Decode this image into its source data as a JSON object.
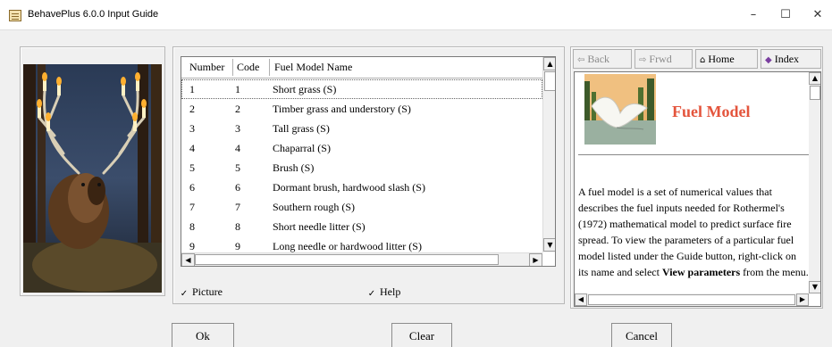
{
  "window": {
    "title": "BehavePlus 6.0.0 Input Guide",
    "controls": {
      "minimize": "–",
      "maximize": "☐",
      "close": "✕"
    }
  },
  "list": {
    "headers": [
      "Number",
      "Code",
      "Fuel Model Name"
    ],
    "rows": [
      {
        "number": "1",
        "code": "1",
        "name": "Short grass (S)"
      },
      {
        "number": "2",
        "code": "2",
        "name": "Timber grass and understory (S)"
      },
      {
        "number": "3",
        "code": "3",
        "name": "Tall grass (S)"
      },
      {
        "number": "4",
        "code": "4",
        "name": "Chaparral (S)"
      },
      {
        "number": "5",
        "code": "5",
        "name": "Brush  (S)"
      },
      {
        "number": "6",
        "code": "6",
        "name": "Dormant brush, hardwood slash (S)"
      },
      {
        "number": "7",
        "code": "7",
        "name": "Southern rough (S)"
      },
      {
        "number": "8",
        "code": "8",
        "name": "Short needle litter (S)"
      },
      {
        "number": "9",
        "code": "9",
        "name": "Long needle or hardwood litter (S)"
      }
    ],
    "selected_index": 0
  },
  "checkboxes": {
    "picture": {
      "label": "Picture",
      "checked": true
    },
    "help": {
      "label": "Help",
      "checked": true
    }
  },
  "nav": {
    "back": "Back",
    "forward": "Frwd",
    "home": "Home",
    "index": "Index"
  },
  "help": {
    "title": "Fuel Model",
    "body_plain": "A fuel model is a set of numerical values that describes the fuel inputs needed for Rothermel's (1972) mathematical model to predict surface fire spread. To view the parameters of a particular fuel model listed under the Guide button, right-click on its name and select ",
    "body_bold": "View parameters",
    "body_end": " from the menu.",
    "title_color": "#e4553d"
  },
  "buttons": {
    "ok": "Ok",
    "clear": "Clear",
    "cancel": "Cancel"
  },
  "icons": {
    "app": "document-icon",
    "back": "arrow-left-icon",
    "forward": "arrow-right-icon",
    "home": "home-icon",
    "index": "book-icon"
  }
}
